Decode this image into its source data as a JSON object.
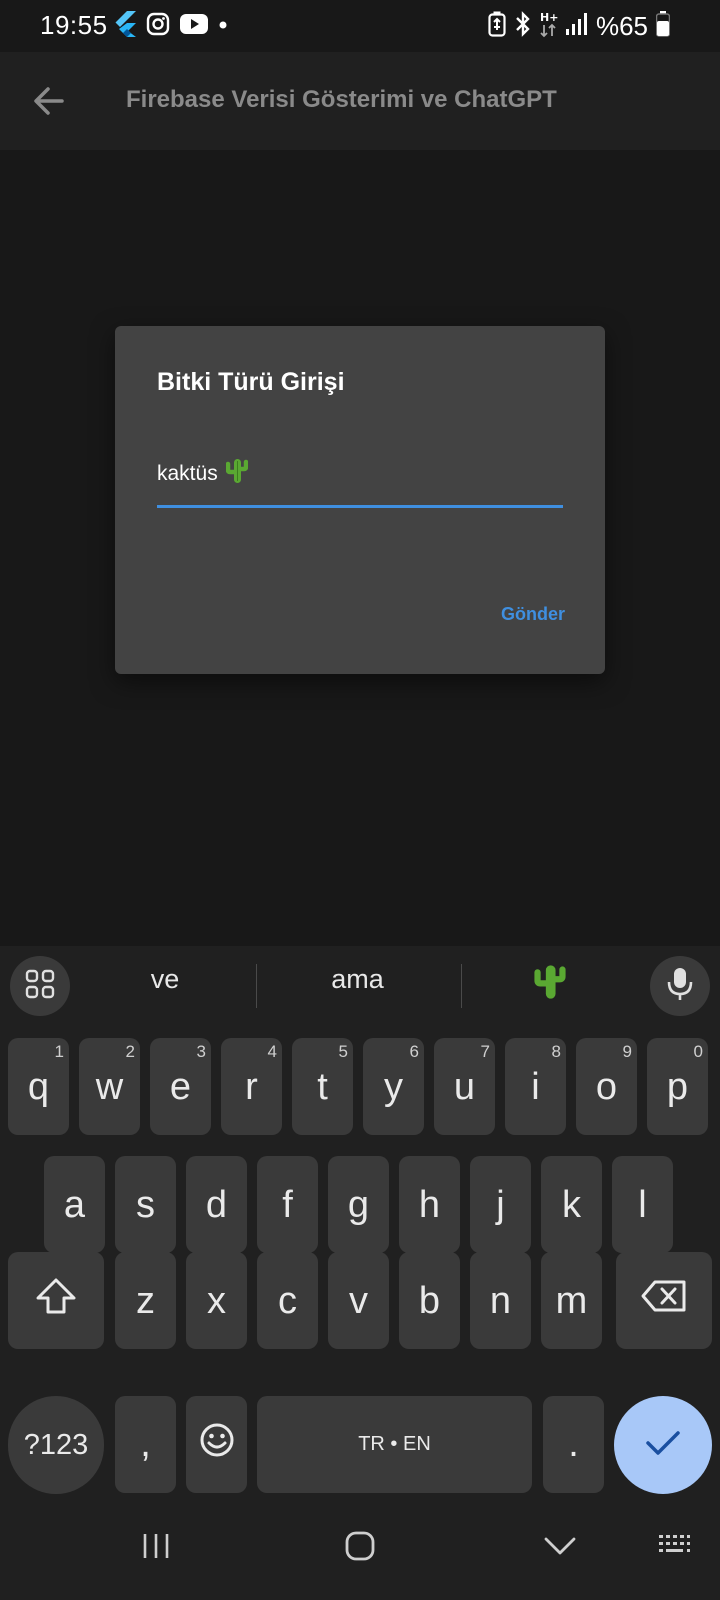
{
  "status_bar": {
    "time": "19:55",
    "battery_text": "%65",
    "left_icons": [
      "flutter-icon",
      "instagram-icon",
      "youtube-icon",
      "dot-icon"
    ],
    "right_icons": [
      "battery-saver-icon",
      "bluetooth-icon",
      "network-hplus-icon",
      "signal-icon",
      "battery-icon"
    ]
  },
  "app_bar": {
    "title": "Firebase Verisi Gösterimi ve ChatGPT",
    "back_icon": "arrow-back-icon"
  },
  "dialog": {
    "title": "Bitki Türü Girişi",
    "input_value": "kaktüs",
    "input_emoji": "cactus-icon",
    "submit_label": "Gönder",
    "accent_color": "#3f8fe0"
  },
  "keyboard": {
    "suggestions": [
      "ve",
      "ama",
      "🌵"
    ],
    "row1": [
      {
        "k": "q",
        "h": "1"
      },
      {
        "k": "w",
        "h": "2"
      },
      {
        "k": "e",
        "h": "3"
      },
      {
        "k": "r",
        "h": "4"
      },
      {
        "k": "t",
        "h": "5"
      },
      {
        "k": "y",
        "h": "6"
      },
      {
        "k": "u",
        "h": "7"
      },
      {
        "k": "i",
        "h": "8"
      },
      {
        "k": "o",
        "h": "9"
      },
      {
        "k": "p",
        "h": "0"
      }
    ],
    "row2": [
      "a",
      "s",
      "d",
      "f",
      "g",
      "h",
      "j",
      "k",
      "l"
    ],
    "row3": [
      "z",
      "x",
      "c",
      "v",
      "b",
      "n",
      "m"
    ],
    "symbols_label": "?123",
    "comma_label": ",",
    "space_label": "TR • EN",
    "period_label": ".",
    "enter_color": "#a8c8f8"
  },
  "nav_bar": {
    "buttons": [
      "recents-icon",
      "home-icon",
      "back-chevron-icon",
      "keyboard-switch-icon"
    ]
  }
}
